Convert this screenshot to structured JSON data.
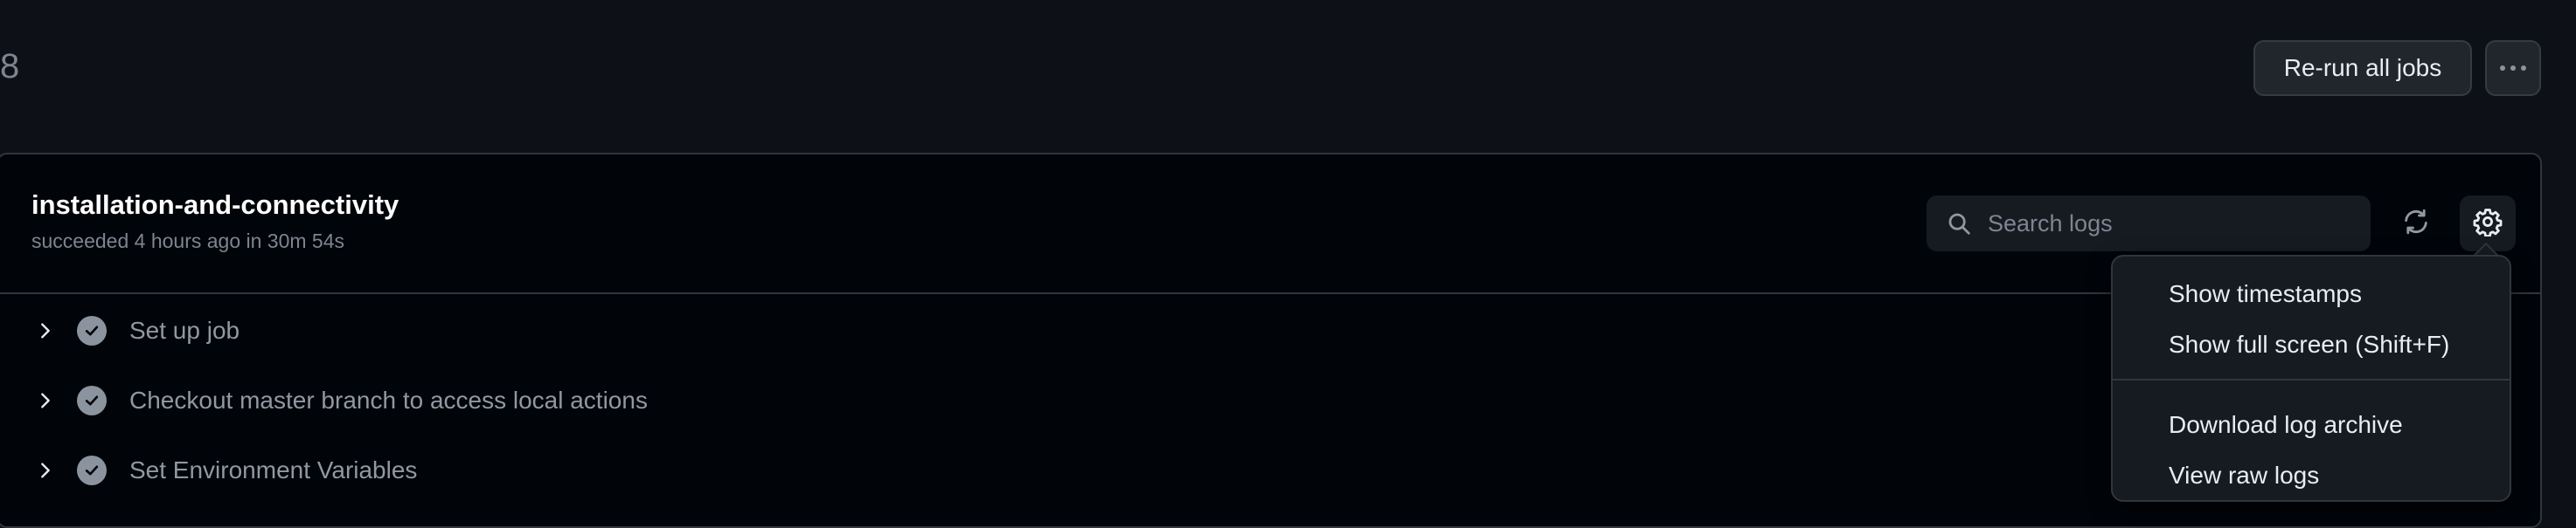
{
  "header": {
    "run_number": "8",
    "rerun_label": "Re-run all jobs"
  },
  "job": {
    "title": "installation-and-connectivity",
    "subtitle": "succeeded 4 hours ago in 30m 54s",
    "search_placeholder": "Search logs"
  },
  "steps": [
    {
      "label": "Set up job",
      "status": "success"
    },
    {
      "label": "Checkout master branch to access local actions",
      "status": "success"
    },
    {
      "label": "Set Environment Variables",
      "status": "success"
    }
  ],
  "settings_menu": {
    "items": [
      {
        "label": "Show timestamps"
      },
      {
        "label": "Show full screen (Shift+F)"
      },
      {
        "label": "Download log archive"
      },
      {
        "label": "View raw logs"
      }
    ]
  },
  "colors": {
    "background": "#0d1117",
    "panel": "#010409",
    "border": "#30363d",
    "muted_text": "#7d8590",
    "success_icon": "#8b949e"
  }
}
